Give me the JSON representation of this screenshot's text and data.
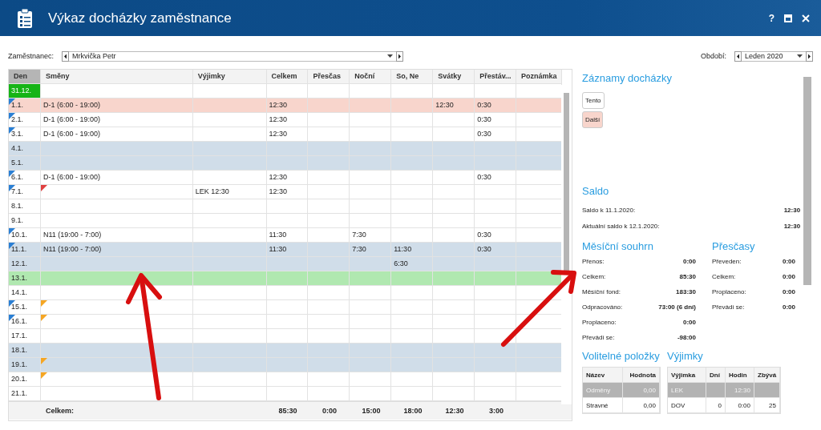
{
  "window": {
    "title": "Výkaz docházky zaměstnance",
    "controls": [
      {
        "kind": "help",
        "label": "?"
      },
      {
        "kind": "maximize"
      },
      {
        "kind": "close"
      }
    ]
  },
  "toolbar": {
    "employee": {
      "label": "Zaměstnanec:",
      "value": "Mrkvička Petr"
    },
    "period": {
      "label": "Období:",
      "value": "Leden 2020"
    }
  },
  "grid": {
    "columns": [
      "Den",
      "Směny",
      "Výjimky",
      "Celkem",
      "Přesčas",
      "Noční",
      "So, Ne",
      "Svátky",
      "Přestáv...",
      "Poznámka"
    ],
    "rows": [
      {
        "kind": "normal",
        "day_highlight": true,
        "day_marker": false,
        "cells": [
          "31.12.",
          "",
          "",
          "",
          "",
          "",
          "",
          "",
          "",
          ""
        ]
      },
      {
        "kind": "holiday",
        "day_highlight": false,
        "day_marker": true,
        "cells": [
          "1.1.",
          "D-1 (6:00 - 19:00)",
          "",
          "12:30",
          "",
          "",
          "",
          "12:30",
          "0:30",
          ""
        ]
      },
      {
        "kind": "normal",
        "day_highlight": false,
        "day_marker": true,
        "cells": [
          "2.1.",
          "D-1 (6:00 - 19:00)",
          "",
          "12:30",
          "",
          "",
          "",
          "",
          "0:30",
          ""
        ]
      },
      {
        "kind": "normal",
        "day_highlight": false,
        "day_marker": true,
        "cells": [
          "3.1.",
          "D-1 (6:00 - 19:00)",
          "",
          "12:30",
          "",
          "",
          "",
          "",
          "0:30",
          ""
        ]
      },
      {
        "kind": "weekend",
        "day_highlight": false,
        "day_marker": false,
        "cells": [
          "4.1.",
          "",
          "",
          "",
          "",
          "",
          "",
          "",
          "",
          ""
        ]
      },
      {
        "kind": "weekend",
        "day_highlight": false,
        "day_marker": false,
        "cells": [
          "5.1.",
          "",
          "",
          "",
          "",
          "",
          "",
          "",
          "",
          ""
        ]
      },
      {
        "kind": "normal",
        "day_highlight": false,
        "day_marker": true,
        "cells": [
          "6.1.",
          "D-1 (6:00 - 19:00)",
          "",
          "12:30",
          "",
          "",
          "",
          "",
          "0:30",
          ""
        ]
      },
      {
        "kind": "normal",
        "day_highlight": false,
        "day_marker": true,
        "shift_flag": {
          "color": "#e04040"
        },
        "cells": [
          "7.1.",
          "",
          "LEK 12:30",
          "12:30",
          "",
          "",
          "",
          "",
          "",
          ""
        ]
      },
      {
        "kind": "normal",
        "day_highlight": false,
        "day_marker": false,
        "cells": [
          "8.1.",
          "",
          "",
          "",
          "",
          "",
          "",
          "",
          "",
          ""
        ]
      },
      {
        "kind": "normal",
        "day_highlight": false,
        "day_marker": false,
        "cells": [
          "9.1.",
          "",
          "",
          "",
          "",
          "",
          "",
          "",
          "",
          ""
        ]
      },
      {
        "kind": "normal",
        "day_highlight": false,
        "day_marker": true,
        "cells": [
          "10.1.",
          "N11 (19:00 - 7:00)",
          "",
          "11:30",
          "",
          "7:30",
          "",
          "",
          "0:30",
          ""
        ]
      },
      {
        "kind": "weekend",
        "day_highlight": false,
        "day_marker": true,
        "cells": [
          "11.1.",
          "N11 (19:00 - 7:00)",
          "",
          "11:30",
          "",
          "7:30",
          "11:30",
          "",
          "0:30",
          ""
        ]
      },
      {
        "kind": "weekend",
        "day_highlight": false,
        "day_marker": false,
        "cells": [
          "12.1.",
          "",
          "",
          "",
          "",
          "",
          "6:30",
          "",
          "",
          ""
        ]
      },
      {
        "kind": "today",
        "day_highlight": false,
        "day_marker": false,
        "cells": [
          "13.1.",
          "",
          "",
          "",
          "",
          "",
          "",
          "",
          "",
          ""
        ]
      },
      {
        "kind": "normal",
        "day_highlight": false,
        "day_marker": false,
        "cells": [
          "14.1.",
          "",
          "",
          "",
          "",
          "",
          "",
          "",
          "",
          ""
        ]
      },
      {
        "kind": "normal",
        "day_highlight": false,
        "day_marker": true,
        "shift_flag": {
          "color": "#f5a623"
        },
        "cells": [
          "15.1.",
          "",
          "",
          "",
          "",
          "",
          "",
          "",
          "",
          ""
        ]
      },
      {
        "kind": "normal",
        "day_highlight": false,
        "day_marker": true,
        "shift_flag": {
          "color": "#f5a623"
        },
        "cells": [
          "16.1.",
          "",
          "",
          "",
          "",
          "",
          "",
          "",
          "",
          ""
        ]
      },
      {
        "kind": "normal",
        "day_highlight": false,
        "day_marker": false,
        "cells": [
          "17.1.",
          "",
          "",
          "",
          "",
          "",
          "",
          "",
          "",
          ""
        ]
      },
      {
        "kind": "weekend",
        "day_highlight": false,
        "day_marker": false,
        "cells": [
          "18.1.",
          "",
          "",
          "",
          "",
          "",
          "",
          "",
          "",
          ""
        ]
      },
      {
        "kind": "weekend",
        "day_highlight": false,
        "day_marker": false,
        "shift_flag": {
          "color": "#f5a623"
        },
        "cells": [
          "19.1.",
          "",
          "",
          "",
          "",
          "",
          "",
          "",
          "",
          ""
        ]
      },
      {
        "kind": "normal",
        "day_highlight": false,
        "day_marker": false,
        "shift_flag": {
          "color": "#f5a623"
        },
        "cells": [
          "20.1.",
          "",
          "",
          "",
          "",
          "",
          "",
          "",
          "",
          ""
        ]
      },
      {
        "kind": "normal",
        "day_highlight": false,
        "day_marker": false,
        "cells": [
          "21.1.",
          "",
          "",
          "",
          "",
          "",
          "",
          "",
          "",
          ""
        ]
      }
    ],
    "totals": {
      "label": "Celkem:",
      "values": [
        "85:30",
        "0:00",
        "15:00",
        "18:00",
        "12:30",
        "3:00"
      ]
    }
  },
  "records": {
    "title": "Záznamy docházky",
    "buttons": [
      {
        "label": "Tento",
        "color": "#ffffff"
      },
      {
        "label": "Další",
        "color": "#f8d5cc"
      }
    ]
  },
  "saldo": {
    "title": "Saldo",
    "rows": [
      {
        "label": "Saldo k 11.1.2020:",
        "value": "12:30"
      },
      {
        "label": "Aktuální saldo k 12.1.2020:",
        "value": "12:30"
      }
    ]
  },
  "monthly": {
    "title": "Měsíční souhrn",
    "rows": [
      {
        "label": "Přenos:",
        "value": "0:00"
      },
      {
        "label": "Celkem:",
        "value": "85:30"
      },
      {
        "label": "Měsíční fond:",
        "value": "183:30"
      },
      {
        "label": "Odpracováno:",
        "value": "73:00 (6 dní)"
      },
      {
        "label": "Proplaceno:",
        "value": "0:00"
      },
      {
        "label": "Převádí se:",
        "value": "-98:00"
      }
    ]
  },
  "overtime": {
    "title": "Přesčasy",
    "rows": [
      {
        "label": "Převeden:",
        "value": "0:00"
      },
      {
        "label": "Celkem:",
        "value": "0:00"
      },
      {
        "label": "Proplaceno:",
        "value": "0:00"
      },
      {
        "label": "Převádí se:",
        "value": "0:00"
      }
    ]
  },
  "optional_items": {
    "title": "Volitelné položky",
    "columns": [
      "Název",
      "Hodnota"
    ],
    "rows": [
      {
        "selected": true,
        "cells": [
          "Odměny",
          "0,00"
        ]
      },
      {
        "selected": false,
        "cells": [
          "Stravné",
          "0,00"
        ]
      }
    ]
  },
  "exceptions": {
    "title": "Výjimky",
    "columns": [
      "Výjimka",
      "Dní",
      "Hodin",
      "Zbývá"
    ],
    "rows": [
      {
        "selected": true,
        "cells": [
          "LEK",
          "",
          "12:30",
          ""
        ]
      },
      {
        "selected": false,
        "cells": [
          "DOV",
          "0",
          "0:00",
          "25"
        ]
      }
    ]
  }
}
